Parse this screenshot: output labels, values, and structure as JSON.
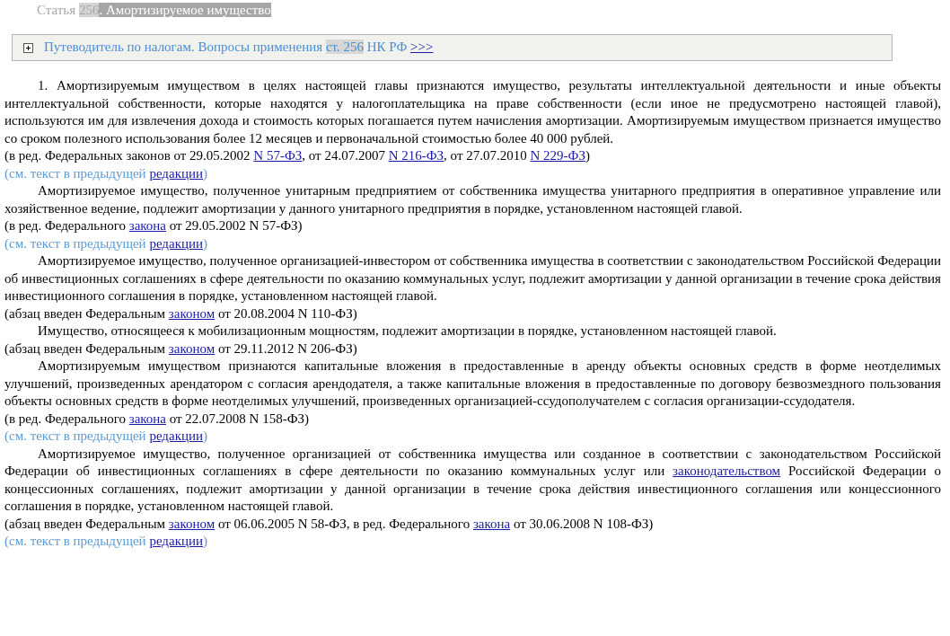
{
  "title": [
    {
      "text": "Статья ",
      "highlighted": false,
      "selected": false
    },
    {
      "text": "256",
      "highlighted": true,
      "selected": false
    },
    {
      "text": ". Амортизируемое имущество",
      "highlighted": false,
      "selected": true
    }
  ],
  "guide": {
    "expanded": false,
    "segments": [
      {
        "text": "Путеводитель по налогам. Вопросы применения ",
        "highlighted": false,
        "link": false
      },
      {
        "text": "ст.",
        "highlighted": true,
        "link": false
      },
      {
        "text": " 256",
        "highlighted": true,
        "link": false
      },
      {
        "text": " НК РФ ",
        "highlighted": false,
        "link": false
      },
      {
        "text": ">>>",
        "highlighted": false,
        "link": true
      }
    ]
  },
  "blocks": [
    {
      "kind": "paragraph",
      "segments": [
        {
          "text": "1. Амортизируемым имуществом в целях настоящей главы признаются имущество, результаты интеллектуальной деятельности и иные объекты интеллектуальной собственности, которые находятся у налогоплательщика на праве собственности (если иное не предусмотрено настоящей главой), используются им для извлечения дохода и стоимость которых погашается путем начисления амортизации. Амортизируемым имуществом признается имущество со сроком полезного использования более 12 месяцев и первоначальной стоимостью более 40 000 рублей.",
          "link": false
        }
      ]
    },
    {
      "kind": "note",
      "segments": [
        {
          "text": "(в ред. Федеральных законов от 29.05.2002 ",
          "link": false
        },
        {
          "text": "N 57-ФЗ",
          "link": true
        },
        {
          "text": ", от 24.07.2007 ",
          "link": false
        },
        {
          "text": "N 216-ФЗ",
          "link": true
        },
        {
          "text": ", от 27.07.2010 ",
          "link": false
        },
        {
          "text": "N 229-ФЗ",
          "link": true
        },
        {
          "text": ")",
          "link": false
        }
      ]
    },
    {
      "kind": "previous_edition",
      "segments": [
        {
          "text": "(см. текст в предыдущей ",
          "link": false
        },
        {
          "text": "редакции",
          "link": true
        },
        {
          "text": ")",
          "link": false
        }
      ]
    },
    {
      "kind": "paragraph",
      "segments": [
        {
          "text": "Амортизируемое имущество, полученное унитарным предприятием от собственника имущества унитарного предприятия в оперативное управление или хозяйственное ведение, подлежит амортизации у данного унитарного предприятия в порядке, установленном настоящей главой.",
          "link": false
        }
      ]
    },
    {
      "kind": "note",
      "segments": [
        {
          "text": "(в ред. Федерального ",
          "link": false
        },
        {
          "text": "закона",
          "link": true
        },
        {
          "text": " от 29.05.2002 N 57-ФЗ)",
          "link": false
        }
      ]
    },
    {
      "kind": "previous_edition",
      "segments": [
        {
          "text": "(см. текст в предыдущей ",
          "link": false
        },
        {
          "text": "редакции",
          "link": true
        },
        {
          "text": ")",
          "link": false
        }
      ]
    },
    {
      "kind": "paragraph",
      "segments": [
        {
          "text": "Амортизируемое имущество, полученное организацией-инвестором от собственника имущества в соответствии с законодательством Российской Федерации об инвестиционных соглашениях в сфере деятельности по оказанию коммунальных услуг, подлежит амортизации у данной организации в течение срока действия инвестиционного соглашения в порядке, установленном настоящей главой.",
          "link": false
        }
      ]
    },
    {
      "kind": "note",
      "segments": [
        {
          "text": "(абзац введен Федеральным ",
          "link": false
        },
        {
          "text": "законом",
          "link": true
        },
        {
          "text": " от 20.08.2004 N 110-ФЗ)",
          "link": false
        }
      ]
    },
    {
      "kind": "paragraph",
      "segments": [
        {
          "text": "Имущество, относящееся к мобилизационным мощностям, подлежит амортизации в порядке, установленном настоящей главой.",
          "link": false
        }
      ]
    },
    {
      "kind": "note",
      "segments": [
        {
          "text": "(абзац введен Федеральным ",
          "link": false
        },
        {
          "text": "законом",
          "link": true
        },
        {
          "text": " от 29.11.2012 N 206-ФЗ)",
          "link": false
        }
      ]
    },
    {
      "kind": "paragraph",
      "segments": [
        {
          "text": "Амортизируемым имуществом признаются капитальные вложения в предоставленные в аренду объекты основных средств в форме неотделимых улучшений, произведенных арендатором с согласия арендодателя, а также капитальные вложения в предоставленные по договору безвозмездного пользования объекты основных средств в форме неотделимых улучшений, произведенных организацией-ссудополучателем с согласия организации-ссудодателя.",
          "link": false
        }
      ]
    },
    {
      "kind": "note",
      "segments": [
        {
          "text": "(в ред. Федерального ",
          "link": false
        },
        {
          "text": "закона",
          "link": true
        },
        {
          "text": " от 22.07.2008 N 158-ФЗ)",
          "link": false
        }
      ]
    },
    {
      "kind": "previous_edition",
      "segments": [
        {
          "text": "(см. текст в предыдущей ",
          "link": false
        },
        {
          "text": "редакции",
          "link": true
        },
        {
          "text": ")",
          "link": false
        }
      ]
    },
    {
      "kind": "paragraph",
      "segments": [
        {
          "text": "Амортизируемое имущество, полученное организацией от собственника имущества или созданное в соответствии с законодательством Российской Федерации об инвестиционных соглашениях в сфере деятельности по оказанию коммунальных услуг или ",
          "link": false
        },
        {
          "text": "законодательством",
          "link": true
        },
        {
          "text": " Российской Федерации о концессионных соглашениях, подлежит амортизации у данной организации в течение срока действия инвестиционного соглашения или концессионного соглашения в порядке, установленном настоящей главой.",
          "link": false
        }
      ]
    },
    {
      "kind": "note",
      "segments": [
        {
          "text": "(абзац введен Федеральным ",
          "link": false
        },
        {
          "text": "законом",
          "link": true
        },
        {
          "text": " от 06.06.2005 N 58-ФЗ, в ред. Федерального ",
          "link": false
        },
        {
          "text": "закона",
          "link": true
        },
        {
          "text": " от 30.06.2008 N 108-ФЗ)",
          "link": false
        }
      ]
    },
    {
      "kind": "previous_edition",
      "segments": [
        {
          "text": "(см. текст в предыдущей ",
          "link": false
        },
        {
          "text": "редакции",
          "link": true
        },
        {
          "text": ")",
          "link": false
        }
      ]
    }
  ]
}
